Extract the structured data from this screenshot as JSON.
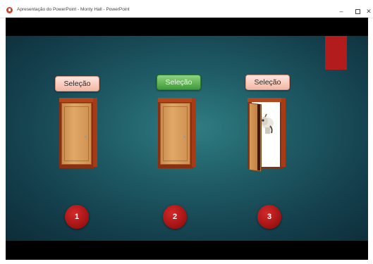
{
  "window": {
    "title": "Apresentação do PowerPoint - Monty Hall - PowerPoint",
    "minimize_label": "–",
    "close_label": "✕"
  },
  "slide": {
    "colors": {
      "background": "#1f5c66",
      "accent_red": "#b31c1c",
      "button_active": "#4caf50",
      "button_default": "#f3b6a4"
    },
    "doors": [
      {
        "label": "Seleção",
        "number": "1",
        "state": "closed",
        "selected": false
      },
      {
        "label": "Seleção",
        "number": "2",
        "state": "closed",
        "selected": true
      },
      {
        "label": "Seleção",
        "number": "3",
        "state": "open-goat",
        "selected": false
      }
    ]
  }
}
